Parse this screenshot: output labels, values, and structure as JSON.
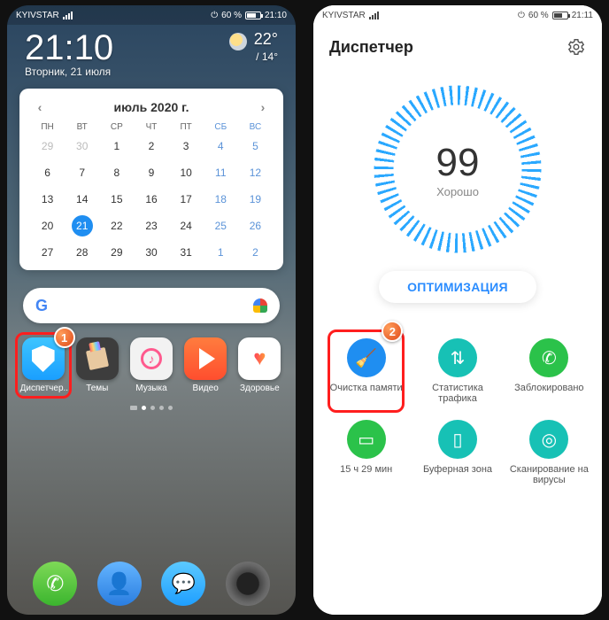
{
  "left": {
    "statusbar": {
      "carrier": "KYIVSTAR",
      "battery": "60 %",
      "time": "21:10"
    },
    "clock": {
      "time": "21:10",
      "date": "Вторник, 21 июля"
    },
    "weather": {
      "hi": "22°",
      "lo": "/ 14°"
    },
    "calendar": {
      "title": "июль 2020 г.",
      "dow": [
        "ПН",
        "ВТ",
        "СР",
        "ЧТ",
        "ПТ",
        "СБ",
        "ВС"
      ],
      "cells": [
        {
          "n": "29",
          "c": "out"
        },
        {
          "n": "30",
          "c": "out"
        },
        {
          "n": "1",
          "c": ""
        },
        {
          "n": "2",
          "c": ""
        },
        {
          "n": "3",
          "c": ""
        },
        {
          "n": "4",
          "c": "we"
        },
        {
          "n": "5",
          "c": "we"
        },
        {
          "n": "6",
          "c": ""
        },
        {
          "n": "7",
          "c": ""
        },
        {
          "n": "8",
          "c": ""
        },
        {
          "n": "9",
          "c": ""
        },
        {
          "n": "10",
          "c": ""
        },
        {
          "n": "11",
          "c": "we"
        },
        {
          "n": "12",
          "c": "we"
        },
        {
          "n": "13",
          "c": ""
        },
        {
          "n": "14",
          "c": ""
        },
        {
          "n": "15",
          "c": ""
        },
        {
          "n": "16",
          "c": ""
        },
        {
          "n": "17",
          "c": ""
        },
        {
          "n": "18",
          "c": "we"
        },
        {
          "n": "19",
          "c": "we"
        },
        {
          "n": "20",
          "c": ""
        },
        {
          "n": "21",
          "c": "today"
        },
        {
          "n": "22",
          "c": ""
        },
        {
          "n": "23",
          "c": ""
        },
        {
          "n": "24",
          "c": ""
        },
        {
          "n": "25",
          "c": "we"
        },
        {
          "n": "26",
          "c": "we"
        },
        {
          "n": "27",
          "c": ""
        },
        {
          "n": "28",
          "c": ""
        },
        {
          "n": "29",
          "c": ""
        },
        {
          "n": "30",
          "c": ""
        },
        {
          "n": "31",
          "c": ""
        },
        {
          "n": "1",
          "c": "out we"
        },
        {
          "n": "2",
          "c": "out we"
        }
      ]
    },
    "apps": {
      "dispatcher": "Диспетчер...",
      "themes": "Темы",
      "music": "Музыка",
      "video": "Видео",
      "health": "Здоровье"
    },
    "callout_badge": "1"
  },
  "right": {
    "statusbar": {
      "carrier": "KYIVSTAR",
      "battery": "60 %",
      "time": "21:11"
    },
    "title": "Диспетчер",
    "score": "99",
    "score_label": "Хорошо",
    "optimize": "ОПТИМИЗАЦИЯ",
    "tiles": {
      "cleanup": "Очистка памяти",
      "traffic": "Статистика трафика",
      "blocked": "Заблокировано",
      "screentime": "15 ч 29 мин",
      "buffer": "Буферная зона",
      "virus": "Сканирование на вирусы"
    },
    "callout_badge": "2"
  }
}
